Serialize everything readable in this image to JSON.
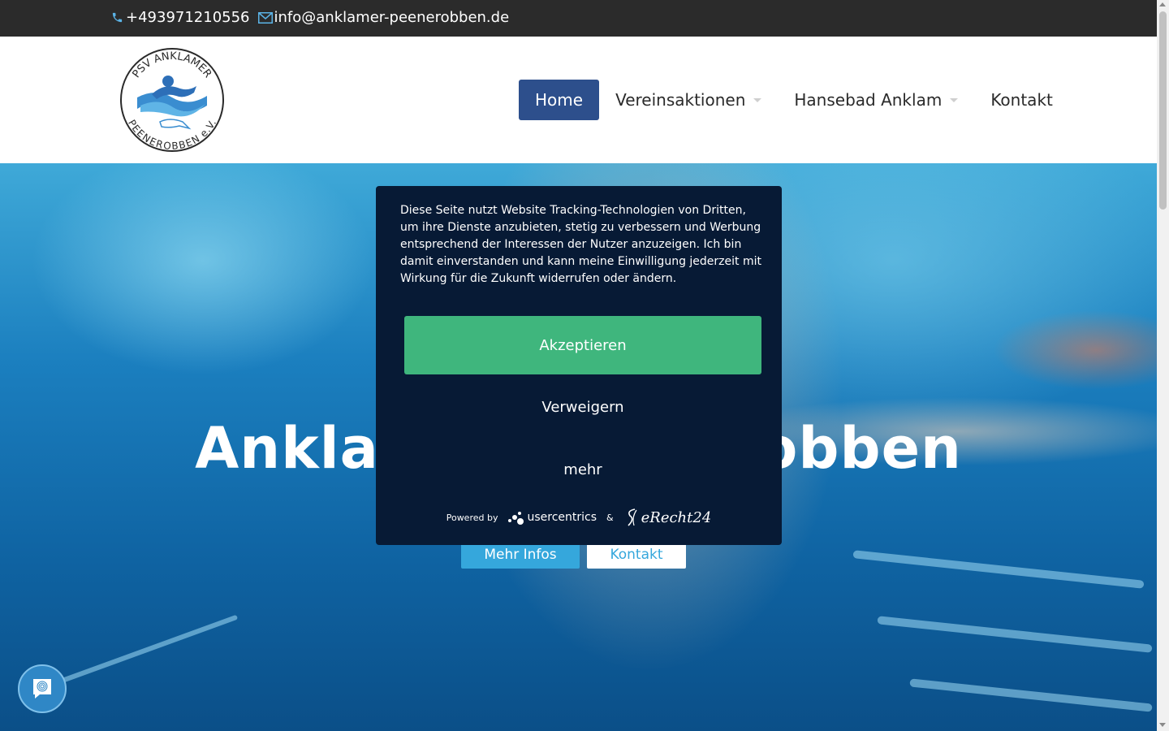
{
  "topbar": {
    "phone": "+493971210556",
    "email": "info@anklamer-peenerobben.de",
    "phone_icon": "phone-icon",
    "email_icon": "envelope-icon"
  },
  "logo": {
    "text_top": "PSV ANKLAMER",
    "text_bottom": "PEENEROBBEN e.V."
  },
  "nav": {
    "items": [
      {
        "label": "Home",
        "active": true,
        "dropdown": false
      },
      {
        "label": "Vereinsaktionen",
        "active": false,
        "dropdown": true
      },
      {
        "label": "Hansebad Anklam",
        "active": false,
        "dropdown": true
      },
      {
        "label": "Kontakt",
        "active": false,
        "dropdown": false
      }
    ],
    "active_color": "#2d4f8c"
  },
  "hero": {
    "title": "Anklamer Peenerobben",
    "more_button": "Mehr Infos",
    "contact_button": "Kontakt",
    "accent_color": "#35a7dc"
  },
  "consent": {
    "text": "Diese Seite nutzt Website Tracking-Technologien von Dritten, um ihre Dienste anzubieten, stetig zu verbessern und Werbung entsprechend der Interessen der Nutzer anzuzeigen. Ich bin damit einverstanden und kann meine Einwilligung jederzeit mit Wirkung für die Zukunft widerrufen oder ändern.",
    "accept": "Akzeptieren",
    "deny": "Verweigern",
    "more": "mehr",
    "powered_by": "Powered by",
    "usercentrics": "usercentrics",
    "ampersand": "&",
    "erecht": "eRecht24",
    "accept_color": "#3fb67d",
    "background": "#071a35"
  },
  "privacy_button": {
    "icon": "fingerprint-icon"
  }
}
